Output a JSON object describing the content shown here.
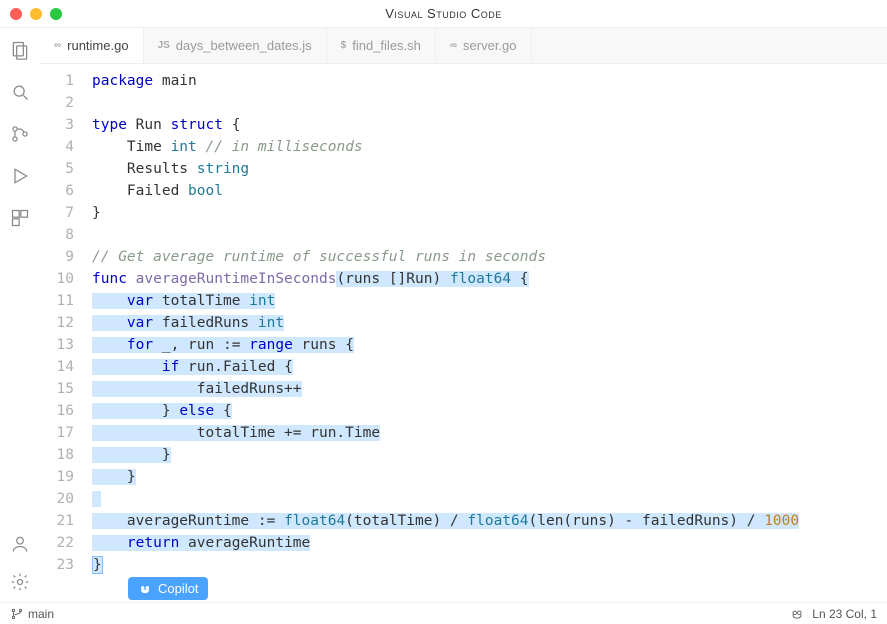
{
  "window_title": "Visual Studio Code",
  "tabs": [
    {
      "icon": "∞",
      "label": "runtime.go",
      "active": true
    },
    {
      "icon": "JS",
      "label": "days_between_dates.js",
      "active": false
    },
    {
      "icon": "$",
      "label": "find_files.sh",
      "active": false
    },
    {
      "icon": "∞",
      "label": "server.go",
      "active": false
    }
  ],
  "code_lines": [
    {
      "n": 1,
      "tokens": [
        [
          "kw",
          "package"
        ],
        [
          "",
          " "
        ],
        [
          "name",
          "main"
        ]
      ]
    },
    {
      "n": 2,
      "tokens": []
    },
    {
      "n": 3,
      "tokens": [
        [
          "kw",
          "type"
        ],
        [
          "",
          " "
        ],
        [
          "name",
          "Run"
        ],
        [
          "",
          " "
        ],
        [
          "kw",
          "struct"
        ],
        [
          "",
          " {"
        ]
      ]
    },
    {
      "n": 4,
      "tokens": [
        [
          "",
          "    "
        ],
        [
          "name",
          "Time"
        ],
        [
          "",
          " "
        ],
        [
          "typ",
          "int"
        ],
        [
          "",
          " "
        ],
        [
          "cm",
          "// in milliseconds"
        ]
      ]
    },
    {
      "n": 5,
      "tokens": [
        [
          "",
          "    "
        ],
        [
          "name",
          "Results"
        ],
        [
          "",
          " "
        ],
        [
          "typ",
          "string"
        ]
      ]
    },
    {
      "n": 6,
      "tokens": [
        [
          "",
          "    "
        ],
        [
          "name",
          "Failed"
        ],
        [
          "",
          " "
        ],
        [
          "typ",
          "bool"
        ]
      ]
    },
    {
      "n": 7,
      "tokens": [
        [
          "",
          "}"
        ]
      ]
    },
    {
      "n": 8,
      "tokens": []
    },
    {
      "n": 9,
      "tokens": [
        [
          "cm",
          "// Get average runtime of successful runs in seconds"
        ]
      ]
    },
    {
      "n": 10,
      "tokens": [
        [
          "kw",
          "func"
        ],
        [
          "",
          " "
        ],
        [
          "fn",
          "averageRuntimeInSeconds"
        ],
        [
          "selstart",
          ""
        ],
        [
          "",
          "(runs []Run) "
        ],
        [
          "typ",
          "float64"
        ],
        [
          "",
          " {"
        ]
      ]
    },
    {
      "n": 11,
      "sel": true,
      "tokens": [
        [
          "",
          "    "
        ],
        [
          "kw",
          "var"
        ],
        [
          "",
          " "
        ],
        [
          "name",
          "totalTime"
        ],
        [
          "",
          " "
        ],
        [
          "typ",
          "int"
        ]
      ]
    },
    {
      "n": 12,
      "sel": true,
      "tokens": [
        [
          "",
          "    "
        ],
        [
          "kw",
          "var"
        ],
        [
          "",
          " "
        ],
        [
          "name",
          "failedRuns"
        ],
        [
          "",
          " "
        ],
        [
          "typ",
          "int"
        ]
      ]
    },
    {
      "n": 13,
      "sel": true,
      "tokens": [
        [
          "",
          "    "
        ],
        [
          "kw",
          "for"
        ],
        [
          "",
          " _, run := "
        ],
        [
          "kw",
          "range"
        ],
        [
          "",
          " runs {"
        ]
      ]
    },
    {
      "n": 14,
      "sel": true,
      "tokens": [
        [
          "",
          "        "
        ],
        [
          "kw",
          "if"
        ],
        [
          "",
          " run.Failed {"
        ]
      ]
    },
    {
      "n": 15,
      "sel": true,
      "tokens": [
        [
          "",
          "            failedRuns++"
        ]
      ]
    },
    {
      "n": 16,
      "sel": true,
      "tokens": [
        [
          "",
          "        } "
        ],
        [
          "kw",
          "else"
        ],
        [
          "",
          " {"
        ]
      ]
    },
    {
      "n": 17,
      "sel": true,
      "tokens": [
        [
          "",
          "            totalTime += run.Time"
        ]
      ]
    },
    {
      "n": 18,
      "sel": true,
      "tokens": [
        [
          "",
          "        }"
        ]
      ]
    },
    {
      "n": 19,
      "sel": true,
      "tokens": [
        [
          "",
          "    }"
        ]
      ]
    },
    {
      "n": 20,
      "sel": true,
      "tokens": []
    },
    {
      "n": 21,
      "sel": true,
      "tokens": [
        [
          "",
          "    averageRuntime := "
        ],
        [
          "typ",
          "float64"
        ],
        [
          "",
          "(totalTime) / "
        ],
        [
          "typ",
          "float64"
        ],
        [
          "",
          "(len(runs) - failedRuns) / "
        ],
        [
          "num",
          "1000"
        ]
      ]
    },
    {
      "n": 22,
      "sel": true,
      "tokens": [
        [
          "",
          "    "
        ],
        [
          "kw",
          "return"
        ],
        [
          "",
          " averageRuntime"
        ]
      ]
    },
    {
      "n": 23,
      "selend": true,
      "tokens": [
        [
          "",
          "}"
        ]
      ]
    }
  ],
  "copilot_label": "Copilot",
  "status": {
    "branch": "main",
    "cursor": "Ln 23 Col, 1"
  }
}
